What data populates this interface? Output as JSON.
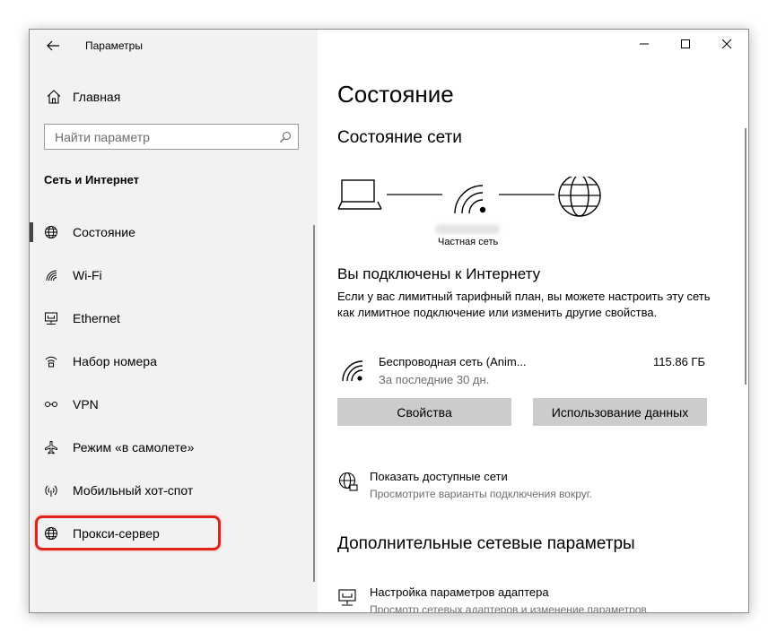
{
  "window": {
    "title": "Параметры"
  },
  "sidebar": {
    "home_label": "Главная",
    "search_placeholder": "Найти параметр",
    "section_title": "Сеть и Интернет",
    "items": [
      {
        "label": "Состояние",
        "icon": "globe-icon",
        "active": true
      },
      {
        "label": "Wi-Fi",
        "icon": "wifi-icon"
      },
      {
        "label": "Ethernet",
        "icon": "ethernet-icon"
      },
      {
        "label": "Набор номера",
        "icon": "dialup-icon"
      },
      {
        "label": "VPN",
        "icon": "vpn-icon"
      },
      {
        "label": "Режим «в самолете»",
        "icon": "airplane-icon"
      },
      {
        "label": "Мобильный хот-спот",
        "icon": "hotspot-icon"
      },
      {
        "label": "Прокси-сервер",
        "icon": "globe-icon",
        "highlighted": true
      }
    ]
  },
  "main": {
    "page_title": "Состояние",
    "network_status_title": "Состояние сети",
    "network_type": "Частная сеть",
    "connected_title": "Вы подключены к Интернету",
    "connected_desc": "Если у вас лимитный тарифный план, вы можете настроить эту сеть как лимитное подключение или изменить другие свойства.",
    "connection": {
      "name": "Беспроводная сеть (Anim...",
      "period": "За последние 30 дн.",
      "usage": "115.86 ГБ"
    },
    "buttons": {
      "properties": "Свойства",
      "data_usage": "Использование данных"
    },
    "show_networks": {
      "title": "Показать доступные сети",
      "subtitle": "Просмотрите варианты подключения вокруг."
    },
    "advanced_title": "Дополнительные сетевые параметры",
    "adapter_settings": {
      "title": "Настройка параметров адаптера",
      "subtitle": "Просмотр сетевых адаптеров и изменение параметров"
    }
  },
  "colors": {
    "sidebar_bg": "#f2f2f2",
    "button_bg": "#cccccc",
    "highlight": "#e2231a",
    "secondary_text": "#6d6d6d"
  }
}
